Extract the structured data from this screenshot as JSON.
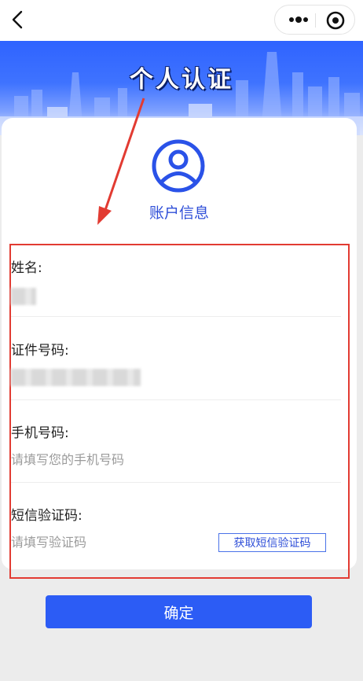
{
  "nav": {
    "back_icon": "chevron-left-icon",
    "more_icon": "more-dots-icon",
    "target_icon": "target-circle-icon"
  },
  "banner": {
    "title": "个人认证",
    "background_color": "#3f73ff"
  },
  "card": {
    "icon": "user-avatar-icon",
    "section_title": "账户信息"
  },
  "form": {
    "name": {
      "label": "姓名:"
    },
    "id_number": {
      "label": "证件号码:"
    },
    "phone": {
      "label": "手机号码:",
      "placeholder": "请填写您的手机号码"
    },
    "sms_code": {
      "label": "短信验证码:",
      "placeholder": "请填写验证码",
      "get_code_label": "获取短信验证码"
    }
  },
  "actions": {
    "confirm_label": "确定",
    "accent_color": "#2c5cf5"
  },
  "annotation": {
    "highlight_color": "#e23b32"
  }
}
